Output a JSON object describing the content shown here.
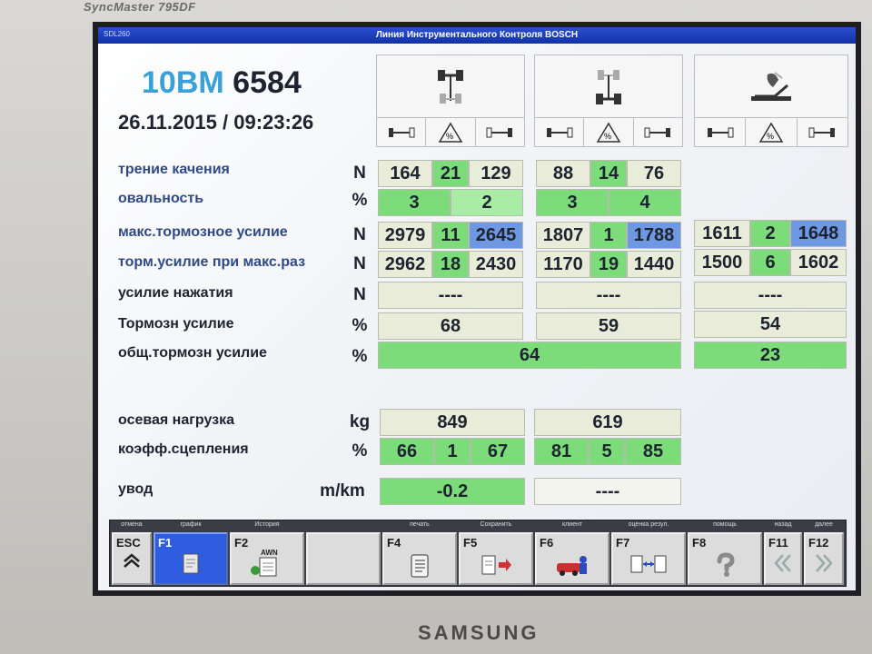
{
  "monitor": {
    "model": "SyncMaster 795DF",
    "brand": "SAMSUNG"
  },
  "window": {
    "sdl": "SDL260",
    "title": "Линия Инструментального Контроля BOSCH"
  },
  "vehicle": {
    "plate_prefix": "10BM",
    "plate_number": "6584",
    "datetime": "26.11.2015 / 09:23:26"
  },
  "rows": {
    "rolling": {
      "label": "трение качения",
      "unit": "N",
      "a1": [
        "164",
        "21",
        "129"
      ],
      "a2": [
        "88",
        "14",
        "76"
      ]
    },
    "ovality": {
      "label": "овальность",
      "unit": "%",
      "a1": [
        "3",
        "2"
      ],
      "a2": [
        "3",
        "4"
      ]
    },
    "maxbrake": {
      "label": "макс.тормозное усилие",
      "unit": "N",
      "a1": [
        "2979",
        "11",
        "2645"
      ],
      "a2": [
        "1807",
        "1",
        "1788"
      ],
      "a3": [
        "1611",
        "2",
        "1648"
      ]
    },
    "brakediff": {
      "label": "торм.усилие при макс.раз",
      "unit": "N",
      "a1": [
        "2962",
        "18",
        "2430"
      ],
      "a2": [
        "1170",
        "19",
        "1440"
      ],
      "a3": [
        "1500",
        "6",
        "1602"
      ]
    },
    "pedal": {
      "label": "усилие нажатия",
      "unit": "N",
      "a1": "----",
      "a2": "----",
      "a3": "----"
    },
    "brakeforce": {
      "label": "Тормозн усилие",
      "unit": "%",
      "a1": "68",
      "a2": "59",
      "a3": "54"
    },
    "totalbrake": {
      "label": "общ.тормозн усилие",
      "unit": "%",
      "main": "64",
      "a3": "23"
    },
    "axleload": {
      "label": "осевая нагрузка",
      "unit": "kg",
      "a1": "849",
      "a2": "619"
    },
    "adhesion": {
      "label": "коэфф.сцепления",
      "unit": "%",
      "a1": [
        "66",
        "1",
        "67"
      ],
      "a2": [
        "81",
        "5",
        "85"
      ]
    },
    "drift": {
      "label": "увод",
      "unit": "m/km",
      "a1": "-0.2",
      "a2": "----"
    }
  },
  "fkeys": [
    {
      "key": "ESC",
      "caption": "отмена",
      "icon": "chevron-up-icon"
    },
    {
      "key": "F1",
      "caption": "график",
      "icon": "document-icon"
    },
    {
      "key": "F2",
      "caption": "История",
      "icon": "history-icon",
      "badge": "AWN"
    },
    {
      "key": "",
      "caption": "",
      "icon": ""
    },
    {
      "key": "F4",
      "caption": "печать",
      "icon": "print-icon"
    },
    {
      "key": "F5",
      "caption": "Сохранить",
      "icon": "save-icon"
    },
    {
      "key": "F6",
      "caption": "клиент",
      "icon": "client-icon"
    },
    {
      "key": "F7",
      "caption": "оценка резул.",
      "icon": "compare-icon"
    },
    {
      "key": "F8",
      "caption": "помощь",
      "icon": "help-icon"
    },
    {
      "key": "F11",
      "caption": "назад",
      "icon": "back-icon"
    },
    {
      "key": "F12",
      "caption": "далее",
      "icon": "forward-icon"
    }
  ],
  "colors": {
    "accent": "#3aa0d8",
    "green": "#7ddc7a",
    "blue": "#6e98e2",
    "beige": "#e8ecd9",
    "active_key": "#2f5de0"
  }
}
